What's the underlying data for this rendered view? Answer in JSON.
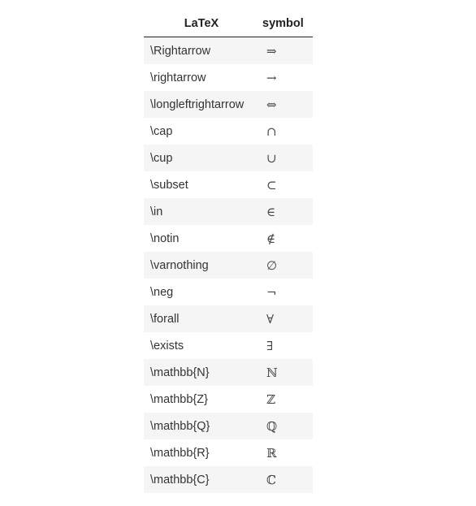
{
  "table": {
    "headers": {
      "latex": "LaTeX",
      "symbol": "symbol"
    },
    "rows": [
      {
        "latex": "\\Rightarrow",
        "symbol": "⇒"
      },
      {
        "latex": "\\rightarrow",
        "symbol": "→"
      },
      {
        "latex": "\\longleftrightarrow",
        "symbol": "⇔"
      },
      {
        "latex": "\\cap",
        "symbol": "∩"
      },
      {
        "latex": "\\cup",
        "symbol": "∪"
      },
      {
        "latex": "\\subset",
        "symbol": "⊂"
      },
      {
        "latex": "\\in",
        "symbol": "∈"
      },
      {
        "latex": "\\notin",
        "symbol": "∉"
      },
      {
        "latex": "\\varnothing",
        "symbol": "∅"
      },
      {
        "latex": "\\neg",
        "symbol": "¬"
      },
      {
        "latex": "\\forall",
        "symbol": "∀"
      },
      {
        "latex": "\\exists",
        "symbol": "∃"
      },
      {
        "latex": "\\mathbb{N}",
        "symbol": "ℕ"
      },
      {
        "latex": "\\mathbb{Z}",
        "symbol": "ℤ"
      },
      {
        "latex": "\\mathbb{Q}",
        "symbol": "ℚ"
      },
      {
        "latex": "\\mathbb{R}",
        "symbol": "ℝ"
      },
      {
        "latex": "\\mathbb{C}",
        "symbol": "ℂ"
      }
    ]
  }
}
